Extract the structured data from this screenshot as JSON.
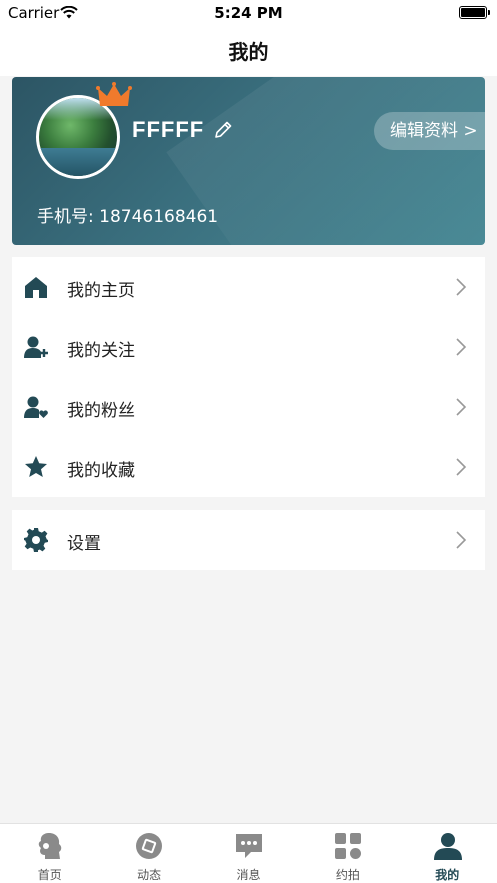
{
  "status_bar": {
    "carrier": "Carrier",
    "time": "5:24 PM"
  },
  "nav": {
    "title": "我的"
  },
  "profile": {
    "username": "FFFFF",
    "edit_button": "编辑资料 >",
    "phone": "手机号: 18746168461"
  },
  "menu": {
    "items": [
      {
        "label": "我的主页",
        "icon": "home-icon"
      },
      {
        "label": "我的关注",
        "icon": "user-plus-icon"
      },
      {
        "label": "我的粉丝",
        "icon": "user-heart-icon"
      },
      {
        "label": "我的收藏",
        "icon": "star-icon"
      }
    ],
    "settings": {
      "label": "设置",
      "icon": "gear-icon"
    }
  },
  "tabbar": {
    "tabs": [
      {
        "label": "首页",
        "icon": "head-profile-icon"
      },
      {
        "label": "动态",
        "icon": "compass-icon"
      },
      {
        "label": "消息",
        "icon": "chat-bubble-icon"
      },
      {
        "label": "约拍",
        "icon": "grid-icon"
      },
      {
        "label": "我的",
        "icon": "person-icon",
        "active": true
      }
    ]
  },
  "colors": {
    "accent": "#234a55",
    "card_start": "#2c5564",
    "card_end": "#4a8a96",
    "crown": "#f07a2c",
    "background": "#f4f4f4"
  }
}
